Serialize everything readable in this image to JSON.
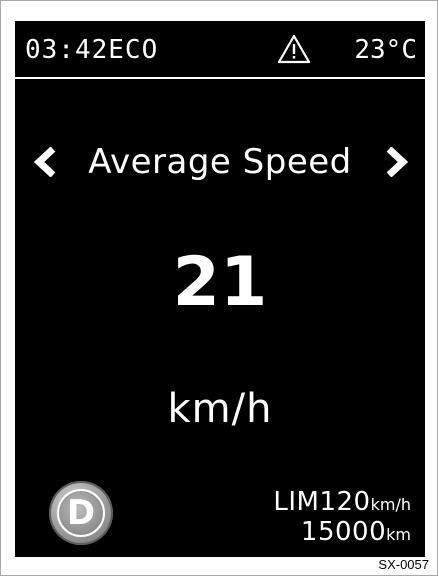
{
  "status_bar": {
    "time": "03:42",
    "mode": "ECO",
    "warning_icon": "warning-triangle-icon",
    "temperature": "23°C"
  },
  "screen": {
    "title": "Average Speed",
    "value": "21",
    "unit": "km/h",
    "prev_icon": "chevron-left-icon",
    "next_icon": "chevron-right-icon"
  },
  "gear": {
    "letter": "D"
  },
  "info": {
    "limit_label": "LIM",
    "limit_value": "120",
    "limit_unit": "km/h",
    "odometer_value": "15000",
    "odometer_unit": "km"
  },
  "figure_ref": "SX-0057",
  "colors": {
    "screen_bg": "#000000",
    "text": "#ffffff",
    "gear_bg": "#9a9a9a"
  }
}
